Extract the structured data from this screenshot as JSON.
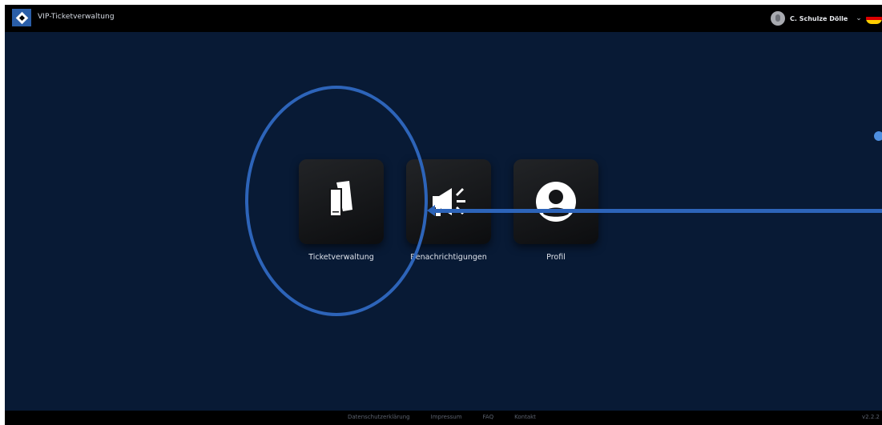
{
  "header": {
    "app_title": "VIP-Ticketverwaltung",
    "user_name": "C. Schulze Dölle",
    "flag_colors": [
      "#000000",
      "#dd0000",
      "#ffce00"
    ]
  },
  "tiles": [
    {
      "label": "Ticketverwaltung",
      "icon": "tickets-icon"
    },
    {
      "label": "Benachrichtigungen",
      "icon": "megaphone-icon"
    },
    {
      "label": "Profil",
      "icon": "user-profile-icon"
    }
  ],
  "footer": {
    "links": [
      "Datenschutzerklärung",
      "Impressum",
      "FAQ",
      "Kontakt"
    ],
    "version": "v2.2.2"
  },
  "colors": {
    "background": "#081a35",
    "bar": "#000000",
    "annotation": "#2d64b9",
    "logo": "#2a5ea8"
  }
}
